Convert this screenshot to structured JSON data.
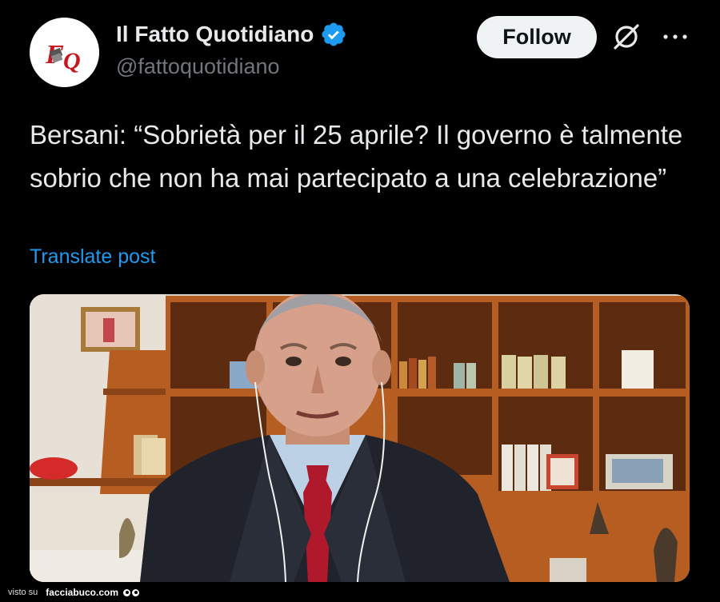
{
  "account": {
    "display_name": "Il Fatto Quotidiano",
    "handle": "@fattoquotidiano",
    "verified_color": "#1d9bf0",
    "avatar_icon": "il-fatto-quotidiano-logo"
  },
  "actions": {
    "follow_label": "Follow",
    "grok_icon": "grok-icon",
    "more_icon": "more-options-icon"
  },
  "post": {
    "text": "Bersani: “Sobrietà per il 25 aprile? Il governo è talmente sobrio che non ha mai partecipato a una celebrazione”",
    "translate_label": "Translate post",
    "link_color": "#1d9bf0"
  },
  "watermark": {
    "prefix": "visto su",
    "site": "facciabuco.com"
  }
}
